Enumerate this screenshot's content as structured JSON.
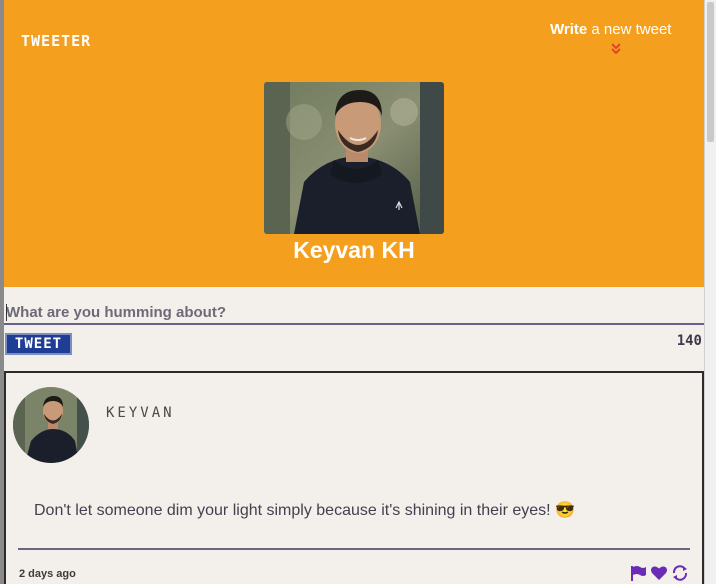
{
  "header": {
    "brand": "TWEETER",
    "compose_toggle": {
      "strong": "Write",
      "rest": " a new tweet"
    },
    "profile_name": "Keyvan KH"
  },
  "compose": {
    "placeholder": "What are you humming about?",
    "submit_label": "TWEET",
    "counter": "140"
  },
  "tweets": [
    {
      "handle": "KEYVAN",
      "text": "Don't let someone dim your light simply because it's shining in their eyes! 😎",
      "time": "2 days ago",
      "actions": [
        "flag-icon",
        "heart-icon",
        "retweet-icon"
      ]
    }
  ],
  "colors": {
    "header_bg": "#f4a01e",
    "page_bg": "#f3efea",
    "accent_purple": "#6a2cb5",
    "button_blue": "#1f3d95",
    "chevron_red": "#e2462a"
  }
}
